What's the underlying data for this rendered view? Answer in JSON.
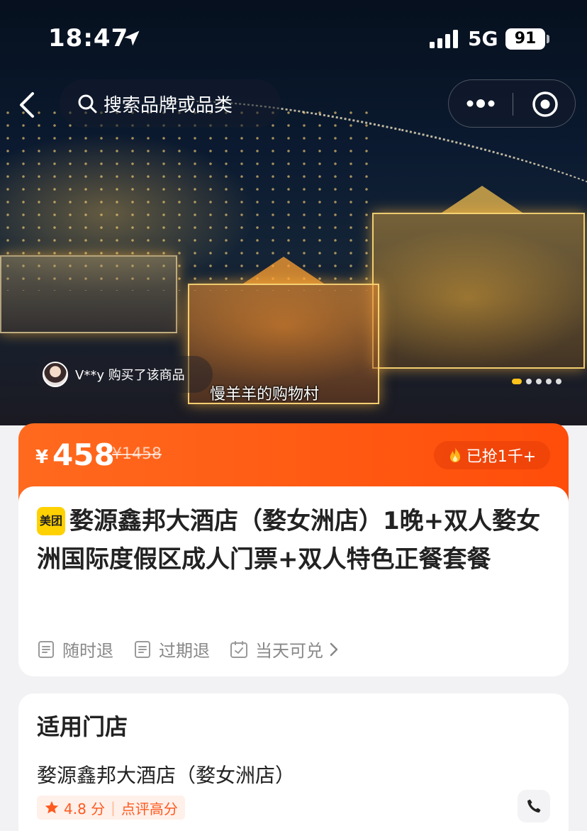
{
  "status_bar": {
    "time": "18:47",
    "network": "5G",
    "battery": "91"
  },
  "nav": {
    "search_placeholder": "搜索品牌或品类"
  },
  "banner": {
    "buyer_text": "V**y 购买了该商品",
    "caption": "慢羊羊的购物村",
    "slide_count": 5,
    "active_slide": 1
  },
  "price_bar": {
    "currency": "¥",
    "price": "458",
    "original_price": "¥1458",
    "sold_label": "已抢1千+"
  },
  "product": {
    "brand_badge": "美团",
    "title": "婺源鑫邦大酒店（婺女洲店）1晚+双人婺女洲国际度假区成人门票+双人特色正餐套餐",
    "policies": [
      "随时退",
      "过期退",
      "当天可兑"
    ]
  },
  "store": {
    "heading": "适用门店",
    "name": "婺源鑫邦大酒店（婺女洲店）",
    "rating": "4.8 分",
    "rating_tag": "点评高分"
  },
  "colors": {
    "accent": "#ff4d0a",
    "brand_yellow": "#ffd100"
  }
}
